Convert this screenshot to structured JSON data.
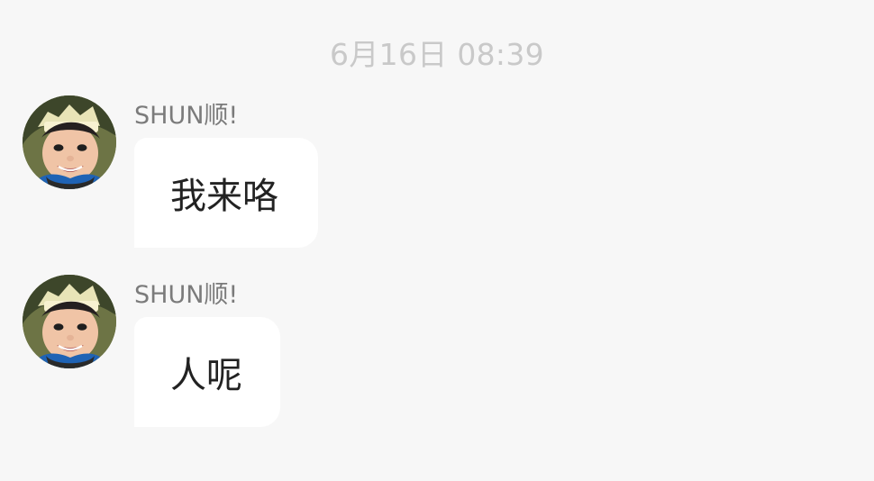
{
  "chat": {
    "timestamp": "6月16日 08:39",
    "messages": [
      {
        "sender": "SHUN顺!",
        "text": "我来咯",
        "avatar_icon": "child-avatar-icon"
      },
      {
        "sender": "SHUN顺!",
        "text": "人呢",
        "avatar_icon": "child-avatar-icon"
      }
    ]
  },
  "colors": {
    "background": "#f7f7f7",
    "bubble": "#ffffff",
    "timestamp_text": "#c9c9c9",
    "sender_text": "#7b7b7b",
    "message_text": "#222222"
  }
}
